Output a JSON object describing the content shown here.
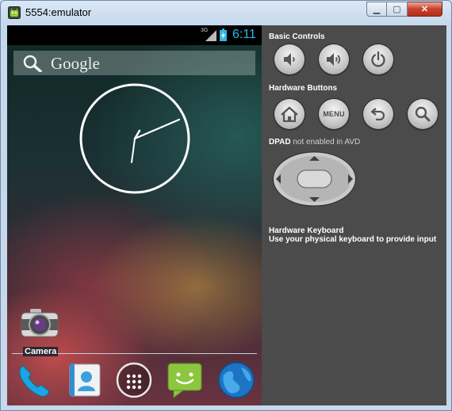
{
  "window": {
    "title": "5554:emulator",
    "min_symbol": "▁",
    "max_symbol": "▢",
    "close_symbol": "✕"
  },
  "status_bar": {
    "network": "3G",
    "time": "6:11",
    "time_color": "#33b5e5"
  },
  "home": {
    "search_label": "Google",
    "camera_label": "Camera",
    "dock_icons": [
      "phone-icon",
      "contacts-icon",
      "all-apps-icon",
      "messaging-icon",
      "browser-icon"
    ]
  },
  "panel": {
    "basic_controls": "Basic Controls",
    "hardware_buttons": "Hardware Buttons",
    "menu_label": "MENU",
    "dpad_title": "DPAD",
    "dpad_note": "not enabled in AVD",
    "keyboard_title": "Hardware Keyboard",
    "keyboard_desc": "Use your physical keyboard to provide input"
  }
}
